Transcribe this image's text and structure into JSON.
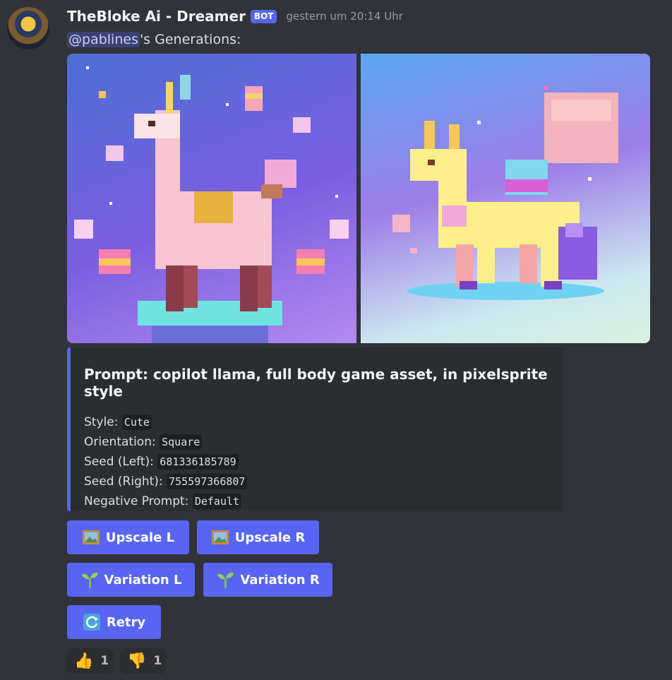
{
  "message": {
    "username": "TheBloke Ai - Dreamer",
    "bot_badge": "BOT",
    "timestamp": "gestern um 20:14 Uhr",
    "mention": "@pablines",
    "content_suffix": "'s Generations:"
  },
  "images": {
    "left_alt": "pixel art llama on pedestal",
    "right_alt": "pixel art yellow llama"
  },
  "embed": {
    "title": "Prompt: copilot llama, full body game asset, in pixelsprite style",
    "fields": [
      {
        "label": "Style:",
        "value": "Cute"
      },
      {
        "label": "Orientation:",
        "value": "Square"
      },
      {
        "label": "Seed (Left):",
        "value": "681336185789"
      },
      {
        "label": "Seed (Right):",
        "value": "755597366807"
      },
      {
        "label": "Negative Prompt:",
        "value": "Default"
      }
    ],
    "accent_color": "#5865f2"
  },
  "buttons": {
    "upscale_l": "Upscale L",
    "upscale_r": "Upscale R",
    "variation_l": "Variation L",
    "variation_r": "Variation R",
    "retry": "Retry",
    "upscale_icon": "framed-picture-icon",
    "variation_icon": "seedling-icon",
    "retry_icon": "arrows-counterclockwise-icon"
  },
  "reactions": [
    {
      "emoji": "👍",
      "count": "1"
    },
    {
      "emoji": "👎",
      "count": "1"
    }
  ],
  "colors": {
    "background": "#313338",
    "blurple": "#5865f2",
    "embed_bg": "#2b2d31"
  }
}
